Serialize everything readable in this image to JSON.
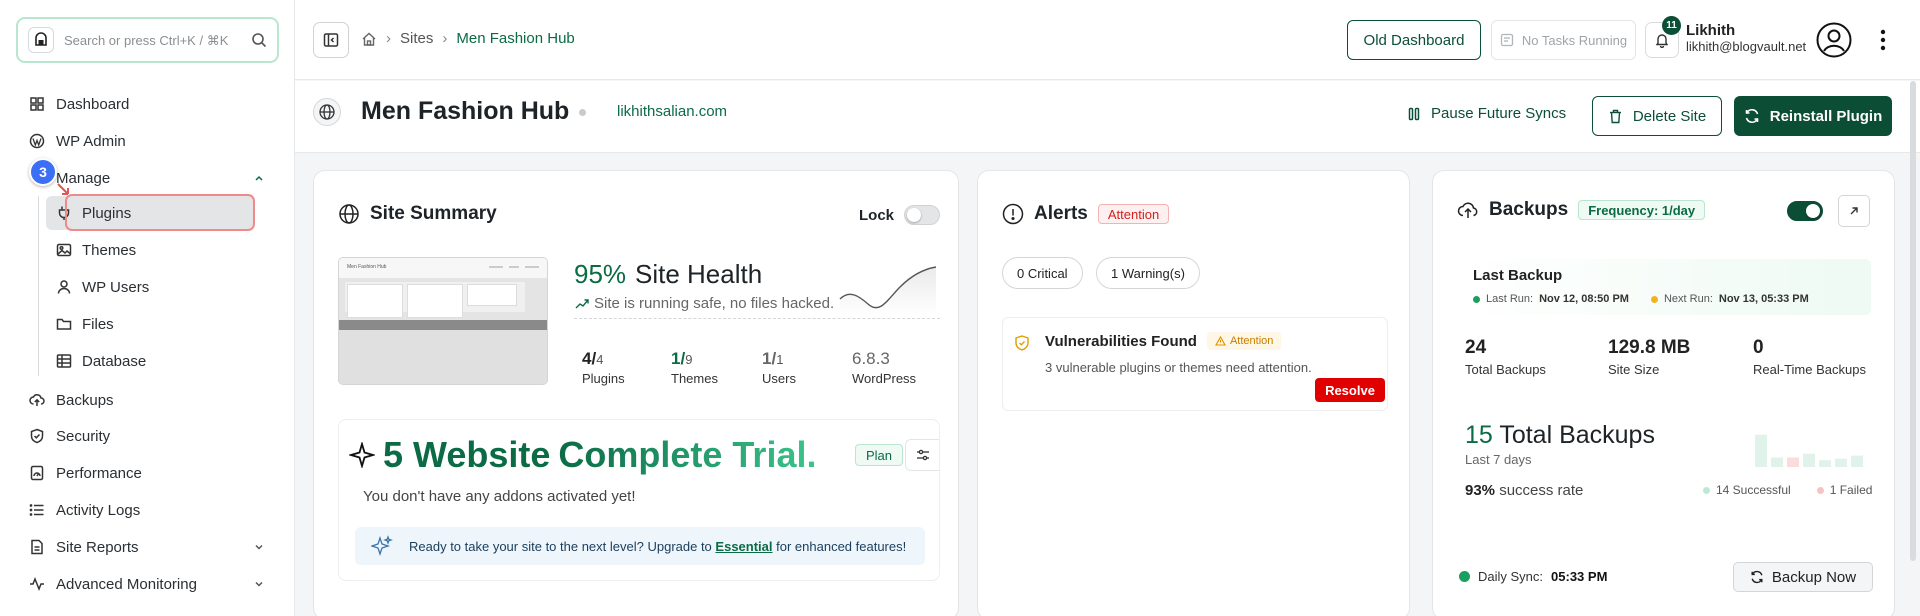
{
  "sidebar": {
    "search_placeholder": "Search or press Ctrl+K / ⌘K",
    "items": [
      {
        "label": "Dashboard",
        "icon": "grid-icon"
      },
      {
        "label": "WP Admin",
        "icon": "wordpress-icon"
      },
      {
        "label": "Manage",
        "icon": "layers-icon"
      },
      {
        "label": "Backups",
        "icon": "cloud-upload-icon"
      },
      {
        "label": "Security",
        "icon": "shield-icon"
      },
      {
        "label": "Performance",
        "icon": "gauge-icon"
      },
      {
        "label": "Activity Logs",
        "icon": "list-icon"
      },
      {
        "label": "Site Reports",
        "icon": "report-icon"
      },
      {
        "label": "Advanced Monitoring",
        "icon": "activity-icon"
      }
    ],
    "manage_sub": [
      {
        "label": "Plugins",
        "icon": "plug-icon"
      },
      {
        "label": "Themes",
        "icon": "image-icon"
      },
      {
        "label": "WP Users",
        "icon": "user-icon"
      },
      {
        "label": "Files",
        "icon": "folder-icon"
      },
      {
        "label": "Database",
        "icon": "table-icon"
      }
    ],
    "step_badge": "3"
  },
  "topbar": {
    "breadcrumb": [
      "Sites",
      "Men Fashion Hub"
    ],
    "old_dashboard": "Old Dashboard",
    "tasks": "No Tasks Running",
    "notifications": "11",
    "user_name": "Likhith",
    "user_email": "likhith@blogvault.net"
  },
  "site": {
    "name": "Men Fashion Hub",
    "url": "likhithsalian.com",
    "pause": "Pause Future Syncs",
    "delete": "Delete Site",
    "reinstall": "Reinstall Plugin"
  },
  "summary": {
    "title": "Site Summary",
    "lock": "Lock",
    "thumb_title": "Men Fashion Hub",
    "health_pct": "95%",
    "health_label": "Site Health",
    "health_status": "Site is running safe, no files hacked.",
    "stats": [
      {
        "num": "4",
        "den": "4",
        "label": "Plugins"
      },
      {
        "num": "1",
        "den": "9",
        "label": "Themes"
      },
      {
        "num": "1",
        "den": "1",
        "label": "Users"
      },
      {
        "num": "6.8.3",
        "den": "",
        "label": "WordPress"
      }
    ],
    "trial_title_1": "5 Website",
    "trial_title_2": "Complete Trial.",
    "plan": "Plan",
    "addons": "You don't have any addons activated yet!",
    "upgrade_pre": "Ready to take your site to the next level? Upgrade to",
    "upgrade_link": "Essential",
    "upgrade_post": "for enhanced features!"
  },
  "alerts": {
    "title": "Alerts",
    "badge": "Attention",
    "critical": "0 Critical",
    "warnings": "1 Warning(s)",
    "vuln_title": "Vulnerabilities Found",
    "vuln_badge": "Attention",
    "vuln_desc": "3 vulnerable plugins or themes need attention.",
    "resolve": "Resolve"
  },
  "backups": {
    "title": "Backups",
    "frequency": "Frequency: 1/day",
    "last_backup": "Last Backup",
    "last_run_label": "Last Run:",
    "last_run": "Nov 12, 08:50 PM",
    "next_run_label": "Next Run:",
    "next_run": "Nov 13, 05:33 PM",
    "total_backups": "24",
    "total_backups_label": "Total Backups",
    "site_size": "129.8 MB",
    "site_size_label": "Site Size",
    "realtime": "0",
    "realtime_label": "Real-Time Backups",
    "week_count": "15",
    "week_label": "Total Backups",
    "week_sub": "Last 7 days",
    "success_rate": "93%",
    "success_label": "success rate",
    "successful": "14 Successful",
    "failed": "1 Failed",
    "daily_label": "Daily Sync:",
    "daily_time": "05:33 PM",
    "backup_now": "Backup Now",
    "bars": [
      {
        "value": 0.85,
        "status": "success"
      },
      {
        "value": 0.25,
        "status": "success"
      },
      {
        "value": 0.25,
        "status": "failed"
      },
      {
        "value": 0.35,
        "status": "success"
      },
      {
        "value": 0.18,
        "status": "success"
      },
      {
        "value": 0.22,
        "status": "success"
      },
      {
        "value": 0.3,
        "status": "success"
      }
    ],
    "colors": {
      "success": "#dff3ea",
      "failed": "#fbdcdc"
    }
  }
}
